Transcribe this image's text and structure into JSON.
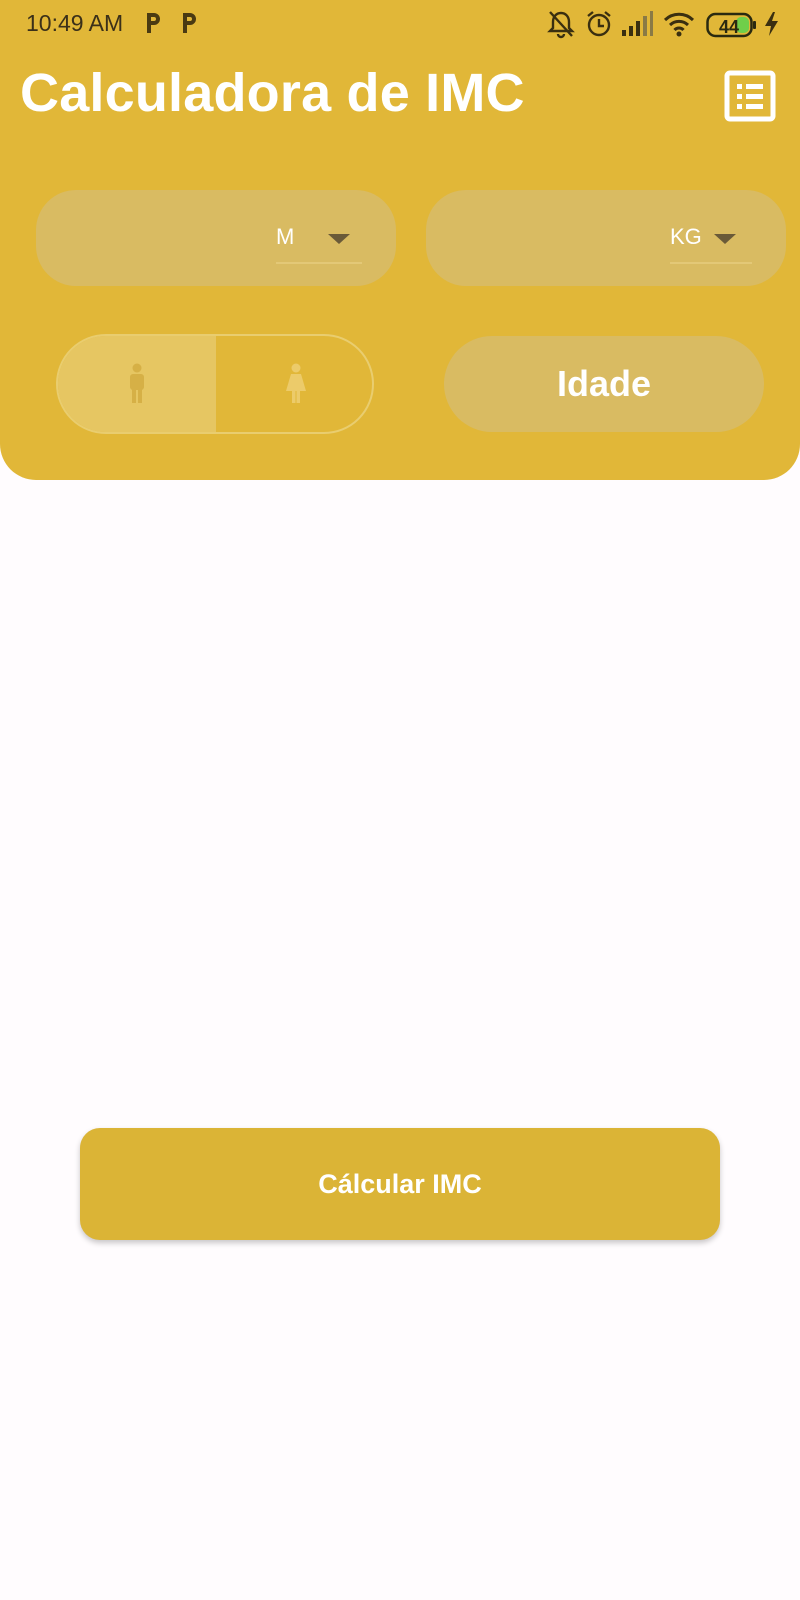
{
  "status_bar": {
    "time": "10:49 AM",
    "notification_icons": [
      "p-app-icon",
      "p-app-icon"
    ],
    "right_icons": [
      "bell-muted-icon",
      "alarm-icon",
      "signal-icon",
      "wifi-icon",
      "battery-icon",
      "charging-bolt-icon"
    ],
    "battery_level": "44"
  },
  "header": {
    "title": "Calculadora de IMC",
    "history_icon": "list-icon"
  },
  "height_field": {
    "value": "",
    "unit": "M"
  },
  "weight_field": {
    "value": "",
    "unit": "KG"
  },
  "gender": {
    "selected": "male",
    "options": [
      "male-icon",
      "female-icon"
    ]
  },
  "age_button": {
    "label": "Idade"
  },
  "calculate_button": {
    "label": "Cálcular IMC"
  },
  "colors": {
    "primary": "#e1b738",
    "field_bg": "#d9bb62",
    "button": "#dbb436",
    "background": "#fffcfe"
  }
}
